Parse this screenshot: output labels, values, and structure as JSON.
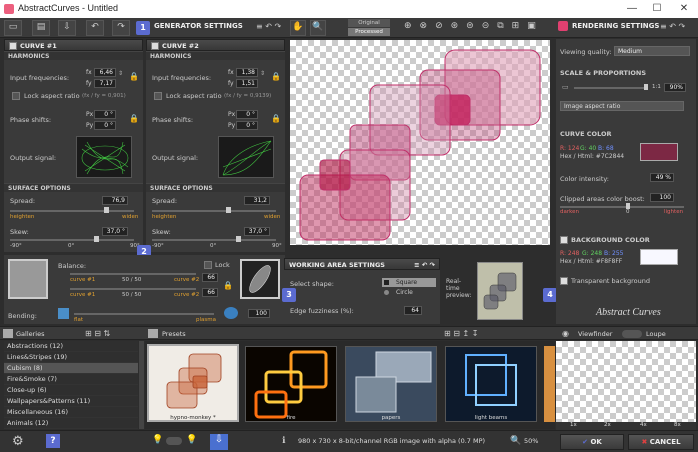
{
  "window": {
    "title": "AbstractCurves - Untitled",
    "app_icon": "abstract-curves-logo",
    "minimize": "—",
    "maximize": "☐",
    "close": "✕"
  },
  "toolbar": {
    "generator_settings": "GENERATOR SETTINGS",
    "original_label": "Original",
    "processed_label": "Processed",
    "rendering_settings": "RENDERING SETTINGS"
  },
  "curve1": {
    "title": "CURVE #1",
    "harmonics": "HARMONICS",
    "input_freq_label": "Input frequencies:",
    "fx_sub": "fx",
    "fy_sub": "fy",
    "fx": "6,46",
    "fy": "7,17",
    "lock_ratio": "Lock aspect ratio",
    "ratio": "(fx / fy = 0,901)",
    "phase_label": "Phase shifts:",
    "px_sub": "Px",
    "py_sub": "Py",
    "px": "0 °",
    "py": "0 °",
    "output_label": "Output signal:",
    "surface": "SURFACE OPTIONS",
    "spread_label": "Spread:",
    "spread": "76,9",
    "spread_left": "heighten",
    "spread_right": "widen",
    "skew_label": "Skew:",
    "skew": "37,0 °",
    "skew_min": "-90°",
    "skew_mid": "0°",
    "skew_max": "90°"
  },
  "curve2": {
    "title": "CURVE #2",
    "harmonics": "HARMONICS",
    "input_freq_label": "Input frequencies:",
    "fx_sub": "fx",
    "fy_sub": "fy",
    "fx": "1,38",
    "fy": "1,51",
    "lock_ratio": "Lock aspect ratio",
    "ratio": "(fx / fy = 0,9139)",
    "phase_label": "Phase shifts:",
    "px_sub": "Px",
    "py_sub": "Py",
    "px": "0 °",
    "py": "0 °",
    "output_label": "Output signal:",
    "surface": "SURFACE OPTIONS",
    "spread_label": "Spread:",
    "spread": "31,2",
    "spread_left": "heighten",
    "spread_right": "widen",
    "skew_label": "Skew:",
    "skew": "37,0 °",
    "skew_min": "-90°",
    "skew_mid": "0°",
    "skew_max": "90°"
  },
  "balance": {
    "label": "Balance:",
    "lock": "Lock",
    "c1a": "curve #1",
    "c2a": "curve #2",
    "v1": "50 / 50",
    "c1b": "curve #1",
    "c2b": "curve #2",
    "v2": "50 / 50",
    "val1": "66",
    "val2": "66",
    "bending_label": "Bending:",
    "flat": "flat",
    "plasma": "plasma",
    "bending": "100"
  },
  "working": {
    "title": "WORKING AREA SETTINGS",
    "shape_label": "Select shape:",
    "square": "Square",
    "circle": "Circle",
    "edge_label": "Edge fuzziness (%):",
    "edge": "64",
    "preview_label": "Real-time preview:"
  },
  "rendering": {
    "quality_label": "Viewing quality:",
    "quality": "Medium",
    "scale_title": "SCALE & PROPORTIONS",
    "scale_value": "90%",
    "scale_ratio": "1:1",
    "aspect": "Image aspect ratio",
    "curve_color": "CURVE COLOR",
    "cc_r": "R: 124",
    "cc_g": "G: 40",
    "cc_b": "B: 68",
    "cc_hex": "Hex / Html:  #7C2844",
    "cc_swatch": "#7c2844",
    "intensity_label": "Color intensity:",
    "intensity": "49 %",
    "clipped_label": "Clipped areas color boost:",
    "clipped": "100",
    "darken": "darken",
    "clip_mid": "0",
    "lighten": "lighten",
    "bg_title": "BACKGROUND COLOR",
    "bg_r": "R: 248",
    "bg_g": "G: 248",
    "bg_b": "B: 255",
    "bg_hex": "Hex / Html:  #F8F8FF",
    "bg_swatch": "#f8f8ff",
    "transparent": "Transparent background",
    "logo": "Abstract Curves"
  },
  "bottom": {
    "galleries": "Galleries",
    "presets": "Presets",
    "viewfinder": "Viewfinder",
    "loupe": "Loupe",
    "zooms": [
      "1x",
      "2x",
      "4x",
      "8x"
    ]
  },
  "galleries": [
    {
      "name": "Abstractions (12)"
    },
    {
      "name": "Lines&Stripes (19)"
    },
    {
      "name": "Cubism (8)"
    },
    {
      "name": "Fire&Smoke (7)"
    },
    {
      "name": "Close-up (6)"
    },
    {
      "name": "Wallpapers&Patterns (11)"
    },
    {
      "name": "Miscellaneous (16)"
    },
    {
      "name": "Animals (12)"
    }
  ],
  "presets": [
    {
      "name": "hypno-monkey *"
    },
    {
      "name": "fire"
    },
    {
      "name": "papers"
    },
    {
      "name": "light beams"
    }
  ],
  "status": {
    "info": "980 x 730 x 8-bit/channel RGB image with alpha  (0.7 MP)",
    "zoom": "50%",
    "ok": "OK",
    "cancel": "CANCEL"
  },
  "badges": [
    "1",
    "2",
    "3",
    "4"
  ]
}
